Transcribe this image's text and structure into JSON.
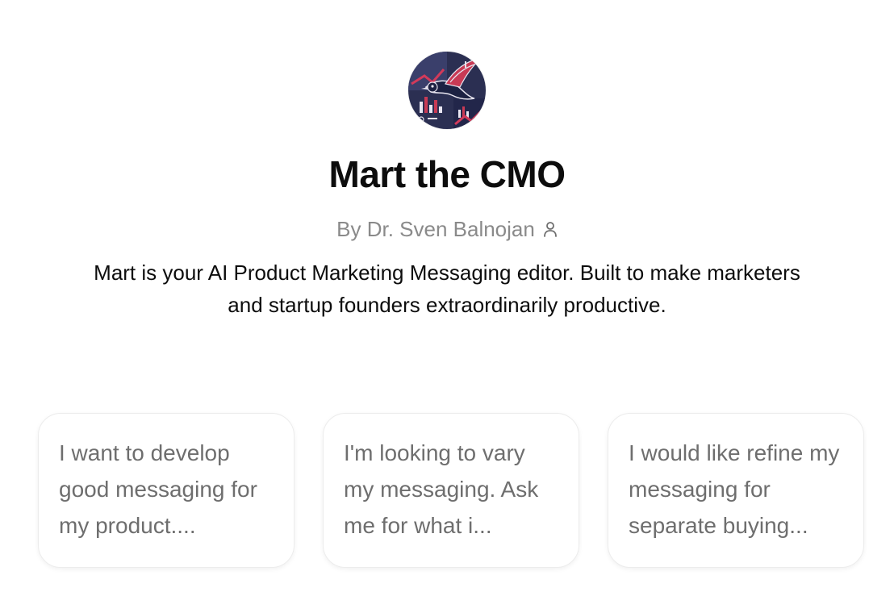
{
  "gpt": {
    "avatar_icon": "bird-logo-avatar",
    "name": "Mart the CMO",
    "byline": "By Dr. Sven Balnojan",
    "byline_icon": "person-icon",
    "description": "Mart is your AI Product Marketing Messaging editor. Built to make marketers and startup founders extraordinarily productive."
  },
  "conversation_starters": [
    {
      "label": "I want to develop good messaging for my product...."
    },
    {
      "label": "I'm looking to vary my messaging. Ask me for what i..."
    },
    {
      "label": "I would like refine my messaging for separate buying..."
    }
  ],
  "colors": {
    "title": "#0d0d0d",
    "byline": "#8a8a8a",
    "card_text": "#6e6e6e",
    "card_border": "#ececec"
  }
}
